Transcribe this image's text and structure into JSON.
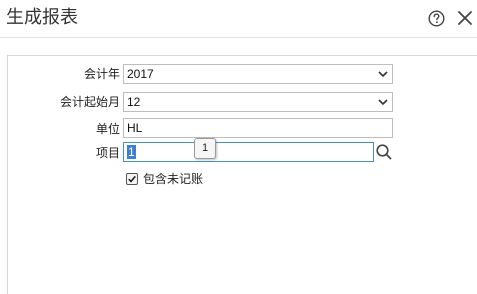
{
  "dialog": {
    "title": "生成报表",
    "help_icon": "question-circle-icon",
    "close_icon": "close-x-icon"
  },
  "form": {
    "fiscal_year": {
      "label": "会计年",
      "value": "2017"
    },
    "start_month": {
      "label": "会计起始月",
      "value": "12"
    },
    "unit": {
      "label": "单位",
      "value": "HL"
    },
    "project": {
      "label": "项目",
      "value": "1",
      "search_icon": "search-icon"
    },
    "tooltip": "1",
    "include_unposted": {
      "label": "包含未记账",
      "checked": true
    }
  },
  "colors": {
    "selection": "#3d7fd4",
    "active_border": "#4a90c4"
  }
}
